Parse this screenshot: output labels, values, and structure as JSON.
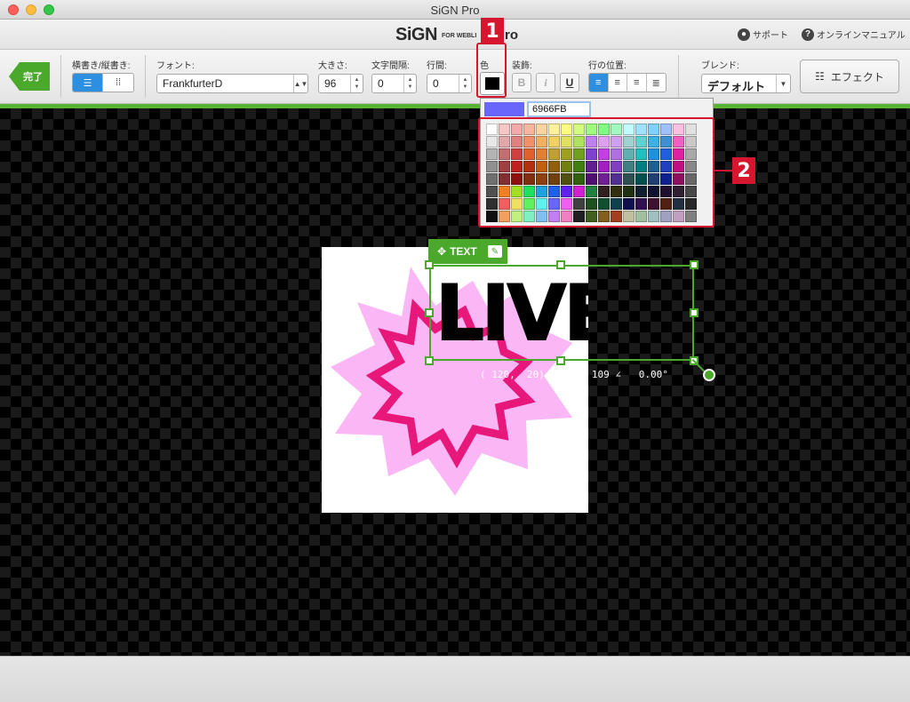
{
  "window": {
    "title": "SiGN Pro"
  },
  "header": {
    "logo": "SiGN",
    "logo_sub": "FOR WEBLI",
    "logo_pro": "ro",
    "support": "サポート",
    "manual": "オンラインマニュアル"
  },
  "toolbar": {
    "done_label": "完了",
    "orientation_label": "横書き/縦書き:",
    "font_label": "フォント:",
    "font_value": "FrankfurterD",
    "size_label": "大きさ:",
    "size_value": "96",
    "spacing_label": "文字間隔:",
    "spacing_value": "0",
    "leading_label": "行間:",
    "leading_value": "0",
    "color_label": "色",
    "deco_label": "装飾:",
    "deco": [
      "B",
      "i",
      "U"
    ],
    "align_label": "行の位置:",
    "blend_label": "ブレンド:",
    "blend_value": "デフォルト",
    "effect_label": "エフェクト"
  },
  "picker": {
    "hex_value": "6966FB",
    "current_color": "#6966FB",
    "selected_index": 140,
    "colors": [
      "#ffffff",
      "#f5c6c6",
      "#f5a9a9",
      "#f7b5a0",
      "#fad4a0",
      "#fff0a0",
      "#fafa80",
      "#d4fa80",
      "#a0fa80",
      "#80fa80",
      "#a0fac0",
      "#c0fafa",
      "#a0e0fa",
      "#80d0fa",
      "#a0c0fa",
      "#fac0e0",
      "#e0e0e0",
      "#e8e8e8",
      "#e0a8a8",
      "#e08080",
      "#f0906a",
      "#f0b060",
      "#f0d060",
      "#e0e060",
      "#b0e060",
      "#c080f0",
      "#e0a0f0",
      "#d0a0f0",
      "#a0d0d0",
      "#60d0d0",
      "#40b0e0",
      "#4090d0",
      "#f060c0",
      "#c8c8c8",
      "#b4b4b4",
      "#c07070",
      "#d04040",
      "#e06030",
      "#e08030",
      "#c0a030",
      "#a0a020",
      "#70a020",
      "#8040d0",
      "#c040e0",
      "#b070e0",
      "#60b0b0",
      "#20c0c0",
      "#2090e0",
      "#2060e0",
      "#e020a0",
      "#a8a8a8",
      "#909090",
      "#a04040",
      "#c02020",
      "#b03010",
      "#c06010",
      "#906010",
      "#708010",
      "#408010",
      "#602090",
      "#a020c0",
      "#8040c0",
      "#408080",
      "#008080",
      "#206090",
      "#2040c0",
      "#c01080",
      "#888888",
      "#707070",
      "#803030",
      "#901010",
      "#803010",
      "#904010",
      "#704010",
      "#505010",
      "#306010",
      "#501070",
      "#702090",
      "#503090",
      "#305050",
      "#005050",
      "#204070",
      "#102090",
      "#901060",
      "#686868",
      "#505050",
      "#f08020",
      "#a0e020",
      "#20e060",
      "#20a0e0",
      "#2060f0",
      "#6020f0",
      "#d020d0",
      "#208040",
      "#302020",
      "#303010",
      "#203010",
      "#102030",
      "#101030",
      "#201030",
      "#302030",
      "#484848",
      "#303030",
      "#f06060",
      "#f0e060",
      "#60f060",
      "#60f0f0",
      "#6966fb",
      "#f060f0",
      "#404040",
      "#205020",
      "#105030",
      "#104050",
      "#101050",
      "#301050",
      "#401030",
      "#502010",
      "#203040",
      "#282828",
      "#101010",
      "#f0a060",
      "#c0f080",
      "#80f0c0",
      "#80c0f0",
      "#c080f0",
      "#f080c0",
      "#202020",
      "#406020",
      "#806020",
      "#a04020",
      "#c0c0a0",
      "#a0c0a0",
      "#a0c0c0",
      "#a0a0c0",
      "#c0a0c0",
      "#808080"
    ]
  },
  "canvas": {
    "text_content": "LIVE",
    "sel_tag": "TEXT",
    "info_text": "( 120,  20)  300 x 109 ∠   0.00°"
  },
  "callouts": {
    "one": "1",
    "two": "2"
  }
}
